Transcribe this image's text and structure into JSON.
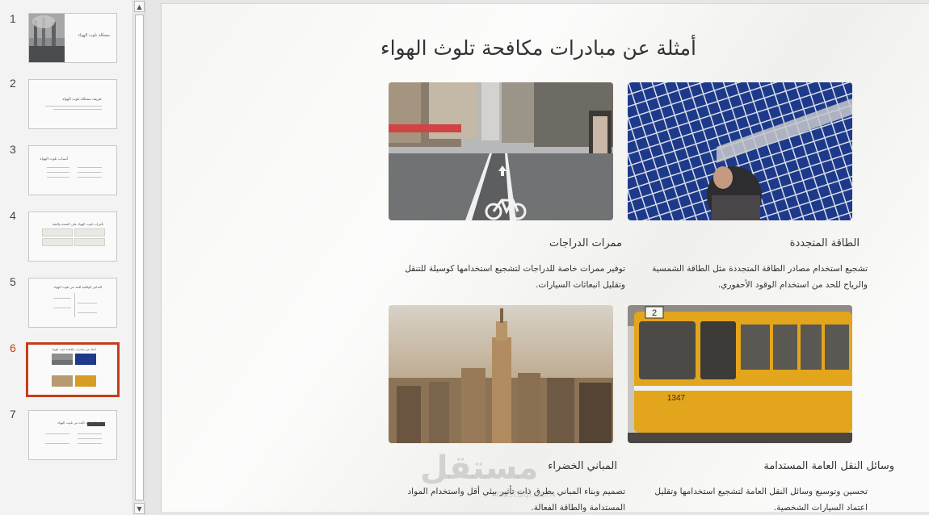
{
  "thumbnails": [
    {
      "number": "1",
      "title": "مشكلة تلوث الهواء"
    },
    {
      "number": "2",
      "title": "تعريف مشكلة تلوث الهواء"
    },
    {
      "number": "3",
      "title": "أسباب تلوث الهواء"
    },
    {
      "number": "4",
      "title": "تأثيرات تلوث الهواء على الصحة والبيئة"
    },
    {
      "number": "5",
      "title": "التدابير الوقائية للحد من تلوث الهواء"
    },
    {
      "number": "6",
      "title": "أمثلة عن مبادرات مكافحة تلوث الهواء",
      "active": true
    },
    {
      "number": "7",
      "title": "استراتيجيات الحد من تلوث الهواء"
    }
  ],
  "slide": {
    "title": "أمثلة عن مبادرات مكافحة تلوث الهواء",
    "cards": [
      {
        "title": "الطاقة المتجددة",
        "desc": "تشجيع استخدام مصادر الطاقة المتجددة مثل الطاقة الشمسية والرياح للحد من استخدام الوقود الأحفوري.",
        "image": "solar-panels"
      },
      {
        "title": "ممرات الدراجات",
        "desc": "توفير ممرات خاصة للدراجات لتشجيع استخدامها كوسيلة للتنقل وتقليل انبعاثات السيارات.",
        "image": "bike-lane"
      },
      {
        "title": "وسائل النقل العامة المستدامة",
        "desc": "تحسين وتوسيع وسائل النقل العامة لتشجيع استخدامها وتقليل اعتماد السيارات الشخصية.",
        "image": "tram"
      },
      {
        "title": "المباني الخضراء",
        "desc": "تصميم وبناء المباني بطرق ذات تأثير بيئي أقل واستخدام المواد المستدامة والطاقة الفعالة.",
        "image": "city-skyline"
      }
    ]
  },
  "tram_number": "1347",
  "tram_route": "2",
  "watermark": {
    "text": "مستقل",
    "sub": "mostaql.com"
  },
  "colors": {
    "accent": "#c43e1c",
    "slide_bg": "#f6f6f4",
    "tram_yellow": "#e3a51c",
    "solar_blue": "#1d3a8a"
  }
}
